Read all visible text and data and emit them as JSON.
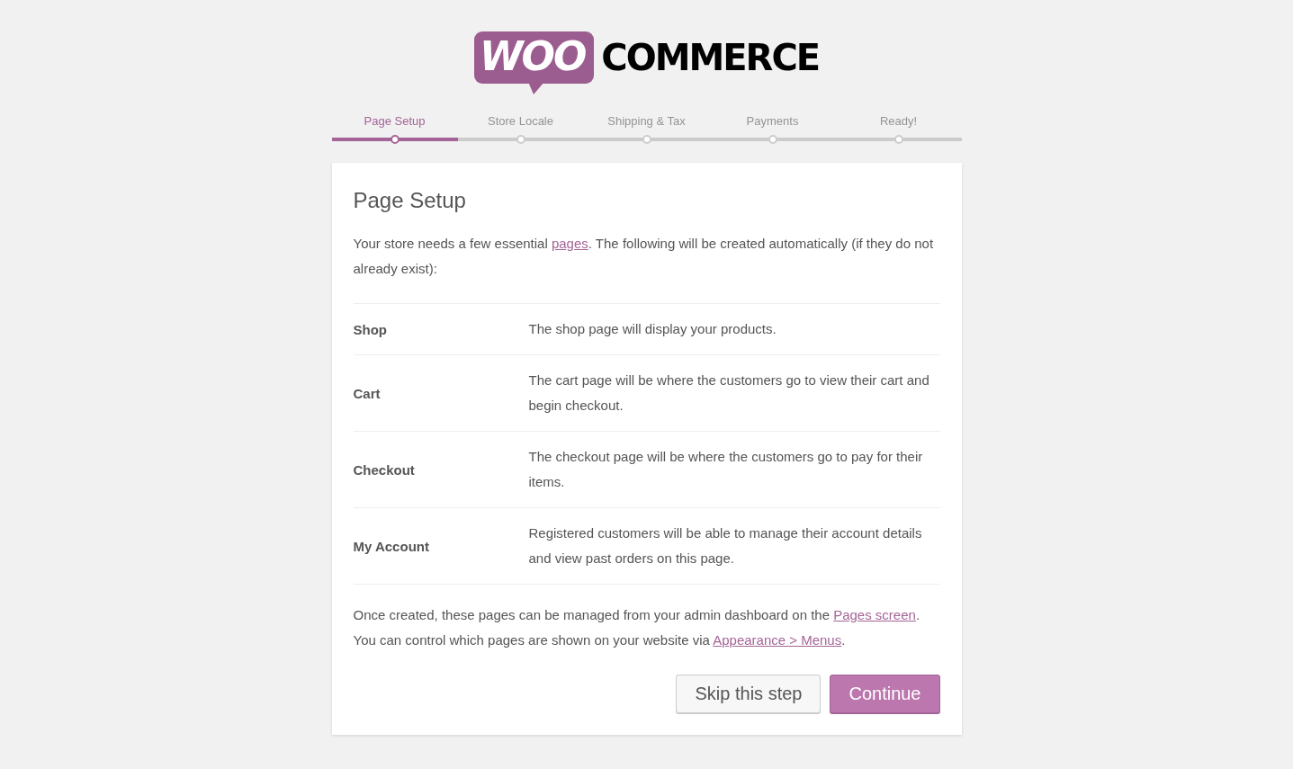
{
  "logo": {
    "badge_text": "WOO",
    "wordmark": "COMMERCE"
  },
  "steps": [
    {
      "label": "Page Setup",
      "selected": true
    },
    {
      "label": "Store Locale",
      "selected": false
    },
    {
      "label": "Shipping & Tax",
      "selected": false
    },
    {
      "label": "Payments",
      "selected": false
    },
    {
      "label": "Ready!",
      "selected": false
    }
  ],
  "card": {
    "title": "Page Setup",
    "intro": [
      {
        "kind": "text",
        "text": "Your store needs a few essential "
      },
      {
        "kind": "link",
        "text": "pages"
      },
      {
        "kind": "text",
        "text": ". The following will be created automatically (if they do not already exist):"
      }
    ],
    "pages": [
      {
        "name": "Shop",
        "description": "The shop page will display your products."
      },
      {
        "name": "Cart",
        "description": "The cart page will be where the customers go to view their cart and begin checkout."
      },
      {
        "name": "Checkout",
        "description": "The checkout page will be where the customers go to pay for their items."
      },
      {
        "name": "My Account",
        "description": "Registered customers will be able to manage their account details and view past orders on this page."
      }
    ],
    "outro": [
      {
        "kind": "text",
        "text": "Once created, these pages can be managed from your admin dashboard on the "
      },
      {
        "kind": "link",
        "text": "Pages screen"
      },
      {
        "kind": "text",
        "text": ". You can control which pages are shown on your website via "
      },
      {
        "kind": "link",
        "text": "Appearance > Menus"
      },
      {
        "kind": "text",
        "text": "."
      }
    ],
    "buttons": [
      {
        "label": "Skip this step",
        "kind": "secondary"
      },
      {
        "label": "Continue",
        "kind": "primary"
      }
    ]
  }
}
